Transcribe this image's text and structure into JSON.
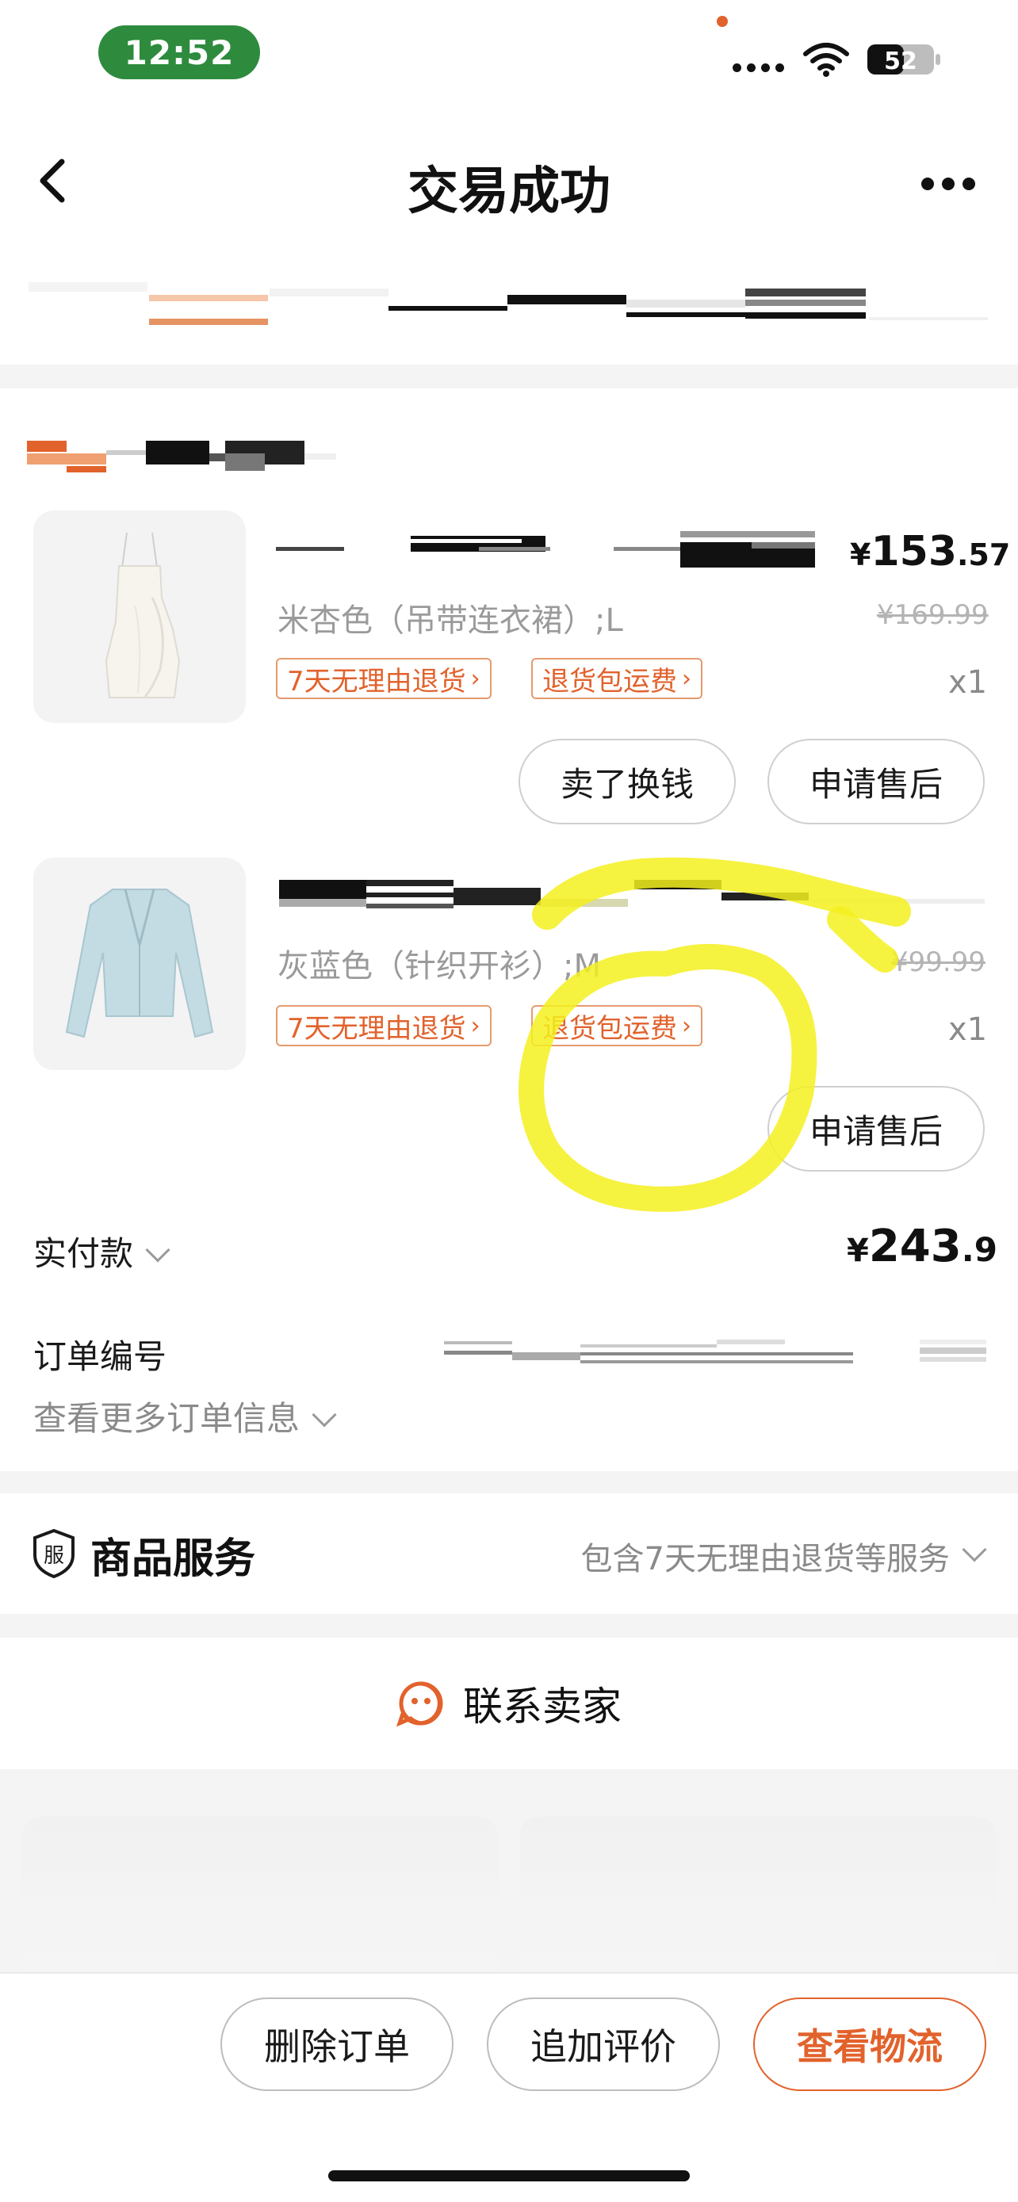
{
  "status_bar": {
    "time": "12:52",
    "battery": "52"
  },
  "nav": {
    "title": "交易成功"
  },
  "items": [
    {
      "spec": "米杏色（吊带连衣裙）;L",
      "price_yen": "¥",
      "price_int": "153",
      "price_dec": ".57",
      "original_price": "¥169.99",
      "quantity": "x1",
      "tags": [
        "7天无理由退货",
        "退货包运费"
      ],
      "actions": [
        "卖了换钱",
        "申请售后"
      ]
    },
    {
      "spec": "灰蓝色（针织开衫）;M",
      "original_price": "¥99.99",
      "quantity": "x1",
      "tags": [
        "7天无理由退货",
        "退货包运费"
      ],
      "actions": [
        "申请售后"
      ]
    }
  ],
  "payment": {
    "label": "实付款",
    "yen": "¥",
    "int": "243",
    "dec": ".9"
  },
  "order": {
    "number_label": "订单编号",
    "more_info": "查看更多订单信息"
  },
  "service": {
    "icon_text": "服",
    "title": "商品服务",
    "desc": "包含7天无理由退货等服务"
  },
  "contact": {
    "label": "联系卖家"
  },
  "bottom_actions": {
    "delete": "删除订单",
    "review": "追加评价",
    "logistics": "查看物流"
  },
  "colors": {
    "accent": "#e2622c",
    "time_pill": "#2e8b3e",
    "annotation": "#f5f01e"
  }
}
